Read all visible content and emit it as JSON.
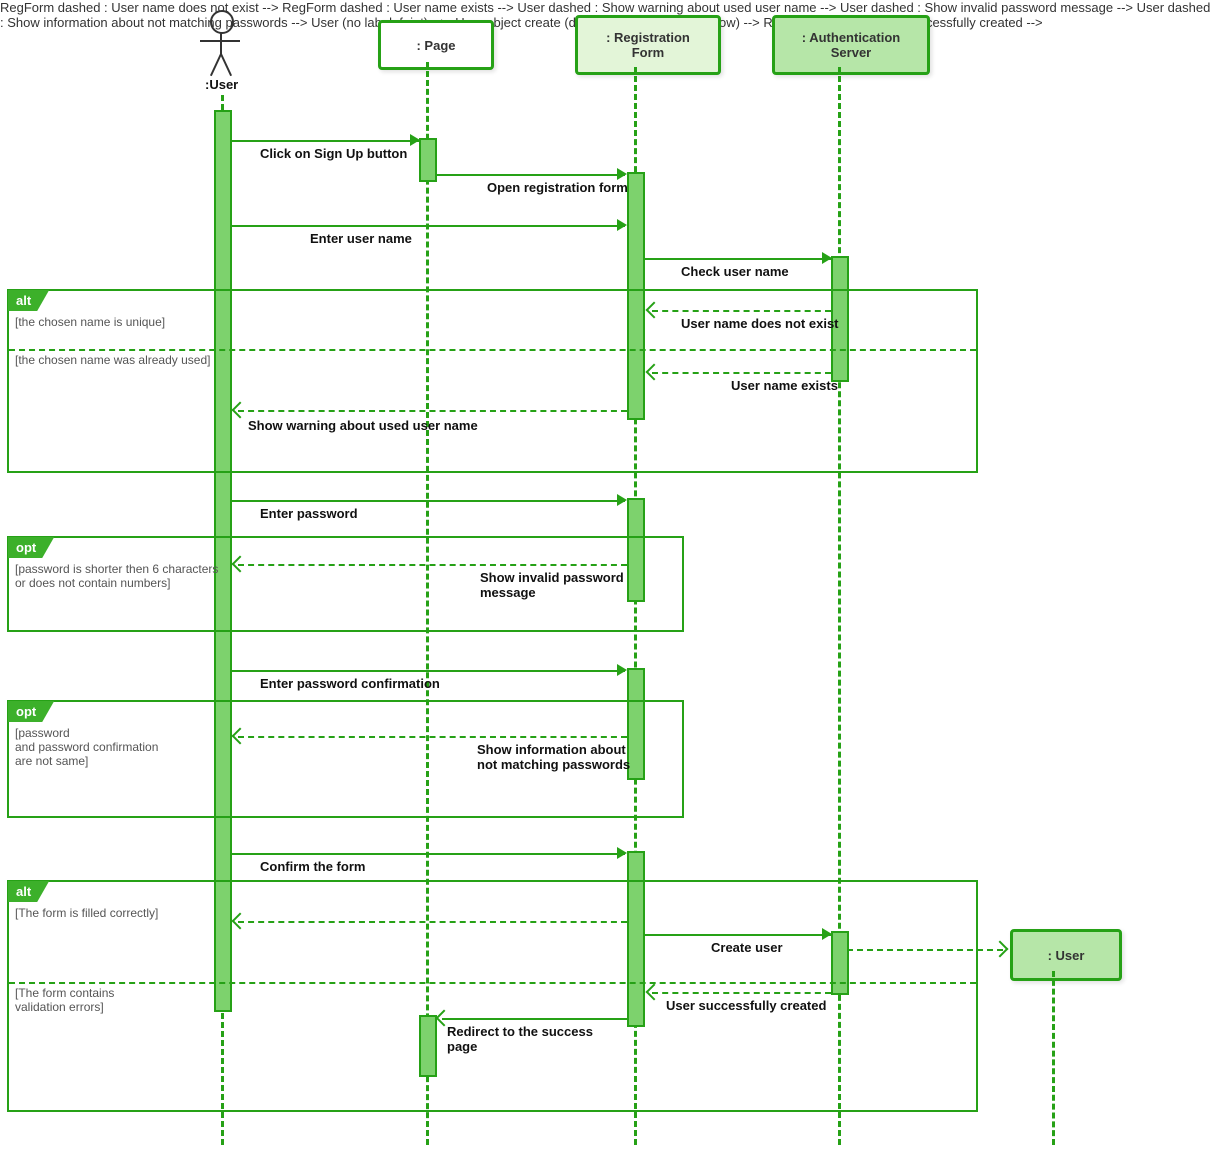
{
  "participants": {
    "user": ":User",
    "page": ": Page",
    "regForm": ": Registration\nForm",
    "authServer": ": Authentication\nServer",
    "userObj": ": User"
  },
  "messages": {
    "m1": "Click on Sign Up button",
    "m2": "Open registration form",
    "m3": "Enter user name",
    "m4": "Check user name",
    "m5": "User name does not exist",
    "m6": "User name exists",
    "m7": "Show warning about used user name",
    "m8": "Enter password",
    "m9": "Show invalid password\nmessage",
    "m10": "Enter password confirmation",
    "m11": "Show information about\nnot matching passwords",
    "m12": "Confirm the form",
    "m13": "Create user",
    "m14": "User successfully created",
    "m15": "Redirect to the success\npage"
  },
  "fragments": {
    "alt1": {
      "type": "alt",
      "guard1": "[the chosen name is unique]",
      "guard2": "[the chosen name was already used]"
    },
    "opt1": {
      "type": "opt",
      "guard": "[password is shorter then 6 characters\nor does not contain numbers]"
    },
    "opt2": {
      "type": "opt",
      "guard": "[password\nand password confirmation\nare not same]"
    },
    "alt2": {
      "type": "alt",
      "guard1": "[The form is filled correctly]",
      "guard2": "[The form contains\nvalidation errors]"
    }
  }
}
